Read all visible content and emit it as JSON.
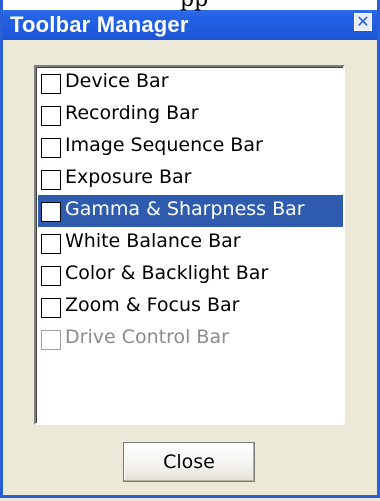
{
  "window": {
    "title": "Toolbar Manager",
    "top_sliver_text": "pp",
    "close_glyph": "✕"
  },
  "list": {
    "items": [
      {
        "label": "Device Bar",
        "checked": false,
        "selected": false,
        "disabled": false
      },
      {
        "label": "Recording Bar",
        "checked": false,
        "selected": false,
        "disabled": false
      },
      {
        "label": "Image Sequence Bar",
        "checked": false,
        "selected": false,
        "disabled": false
      },
      {
        "label": "Exposure Bar",
        "checked": false,
        "selected": false,
        "disabled": false
      },
      {
        "label": "Gamma & Sharpness Bar",
        "checked": false,
        "selected": true,
        "disabled": false
      },
      {
        "label": "White Balance Bar",
        "checked": false,
        "selected": false,
        "disabled": false
      },
      {
        "label": "Color & Backlight Bar",
        "checked": false,
        "selected": false,
        "disabled": false
      },
      {
        "label": "Zoom & Focus Bar",
        "checked": false,
        "selected": false,
        "disabled": false
      },
      {
        "label": "Drive Control Bar",
        "checked": false,
        "selected": false,
        "disabled": true
      }
    ]
  },
  "buttons": {
    "close_label": "Close"
  },
  "colors": {
    "titlebar": "#2563e6",
    "selection": "#2f5caf",
    "disabled_text": "#8c8c8c",
    "dialog_bg": "#ece9d8"
  }
}
